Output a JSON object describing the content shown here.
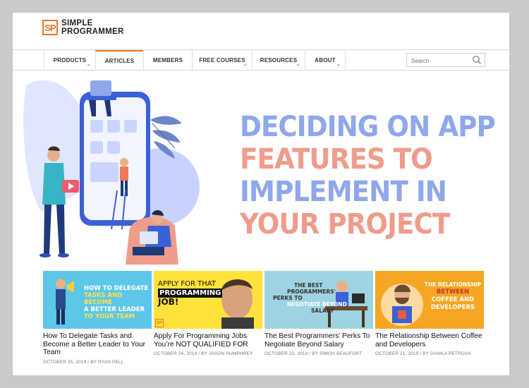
{
  "brand": {
    "mark": "SP",
    "line1": "SIMPLE",
    "line2": "PROGRAMMER",
    "accent": "#e37a27"
  },
  "nav": {
    "items": [
      {
        "label": "PRODUCTS",
        "has_dropdown": true
      },
      {
        "label": "ARTICLES",
        "has_dropdown": false,
        "active": true
      },
      {
        "label": "MEMBERS",
        "has_dropdown": false
      },
      {
        "label": "FREE COURSES",
        "has_dropdown": true
      },
      {
        "label": "RESOURCES",
        "has_dropdown": true
      },
      {
        "label": "ABOUT",
        "has_dropdown": true
      }
    ],
    "search_placeholder": "Search",
    "search_icon": "magnifier-icon"
  },
  "hero": {
    "lines": [
      "DECIDING ON APP",
      "FEATURES TO",
      "IMPLEMENT IN",
      "YOUR PROJECT"
    ],
    "colors": [
      "#8fa7eb",
      "#ef9c8b"
    ]
  },
  "cards": [
    {
      "thumb_lines": [
        "HOW TO DELEGATE",
        "TASKS AND BECOME",
        "A BETTER LEADER",
        "TO YOUR TEAM"
      ],
      "title": "How To Delegate Tasks and Become a Better Leader to Your Team",
      "meta": "OCTOBER 25, 2019 / BY RYAN PELL"
    },
    {
      "thumb_lines": [
        "APPLY FOR THAT",
        "PROGRAMMING",
        "JOB!"
      ],
      "badge": "SP",
      "title": "Apply For Programming Jobs You’re NOT QUALIFIED FOR",
      "meta": "OCTOBER 24, 2019 / BY JASON HUMPHREY"
    },
    {
      "thumb_lines": [
        "THE BEST",
        "PROGRAMMERS'",
        "PERKS TO",
        "NEGOTIATE BEYOND",
        "SALARY"
      ],
      "title": "The Best Programmers’ Perks To Negotiate Beyond Salary",
      "meta": "OCTOBER 23, 2019 / BY SIMON BEAUFORT"
    },
    {
      "thumb_lines": [
        "THE RELATIONSHIP",
        "BETWEEN",
        "COFFEE AND",
        "DEVELOPERS"
      ],
      "title": "The Relationship Between Coffee and Developers",
      "meta": "OCTOBER 21, 2019 / BY DANILA PETROVA"
    }
  ]
}
